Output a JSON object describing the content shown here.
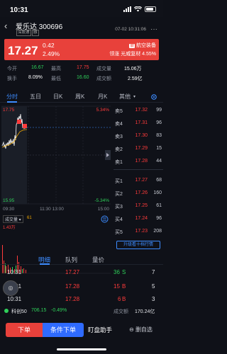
{
  "status_bar": {
    "time": "10:31"
  },
  "header": {
    "title": "爱乐达 300696",
    "tags": [
      "深股通",
      "融"
    ],
    "datetime": "07-02 10:31:06"
  },
  "price_banner": {
    "price": "17.27",
    "change": "0.42",
    "change_pct": "2.49%",
    "sector_tag": "联",
    "sector_name": "航空装备",
    "lead_text": "领涨 光威复材 4.55%"
  },
  "stats": {
    "row1": {
      "open_label": "今开",
      "open": "16.67",
      "high_label": "最高",
      "high": "17.75",
      "volume_label": "成交量",
      "volume": "15.06万"
    },
    "row2": {
      "turnover_label": "换手",
      "turnover": "8.09%",
      "low_label": "最低",
      "low": "16.60",
      "amount_label": "成交额",
      "amount": "2.59亿"
    }
  },
  "period_tabs": [
    "分时",
    "五日",
    "日K",
    "周K",
    "月K",
    "其他"
  ],
  "chart": {
    "upper_price": "17.75",
    "upper_pct": "5.34%",
    "lower_price": "15.95",
    "lower_pct": "-5.34%",
    "time_start": "09:30",
    "time_mid": "11:30 13:00",
    "time_end": "15:00",
    "volume_label": "成交量",
    "volume_value": "61",
    "volume_max": "1.43万"
  },
  "order_book": {
    "asks": [
      {
        "label": "卖5",
        "price": "17.32",
        "vol": "99"
      },
      {
        "label": "卖4",
        "price": "17.31",
        "vol": "96"
      },
      {
        "label": "卖3",
        "price": "17.30",
        "vol": "83"
      },
      {
        "label": "卖2",
        "price": "17.29",
        "vol": "15"
      },
      {
        "label": "卖1",
        "price": "17.28",
        "vol": "44"
      }
    ],
    "bids": [
      {
        "label": "买1",
        "price": "17.27",
        "vol": "68"
      },
      {
        "label": "买2",
        "price": "17.26",
        "vol": "160"
      },
      {
        "label": "买3",
        "price": "17.25",
        "vol": "61"
      },
      {
        "label": "买4",
        "price": "17.24",
        "vol": "96"
      },
      {
        "label": "买5",
        "price": "17.23",
        "vol": "208"
      }
    ],
    "more_label": "升级看十档行情"
  },
  "sub_tabs": [
    "明细",
    "队列",
    "量价"
  ],
  "trades": [
    {
      "time": "10:31",
      "price": "17.27",
      "vol": "36",
      "side": "S",
      "count": "7"
    },
    {
      "time": "10:31",
      "price": "17.28",
      "vol": "15",
      "side": "B",
      "count": "5"
    },
    {
      "time": "10:31",
      "price": "17.28",
      "vol": "6",
      "side": "B",
      "count": "3"
    }
  ],
  "ticker": {
    "name": "科创50",
    "value": "706.15",
    "pct": "-0.49%",
    "amount_label": "成交额",
    "amount": "170.24亿"
  },
  "bottom_bar": {
    "order_label": "下单",
    "cond_label": "条件下单",
    "helper_label": "盯盘助手",
    "fav_label": "删自选"
  },
  "colors": {
    "up": "#ff3b3b",
    "down": "#2fd05a",
    "accent": "#3d8cff",
    "banner": "#e8413b"
  }
}
